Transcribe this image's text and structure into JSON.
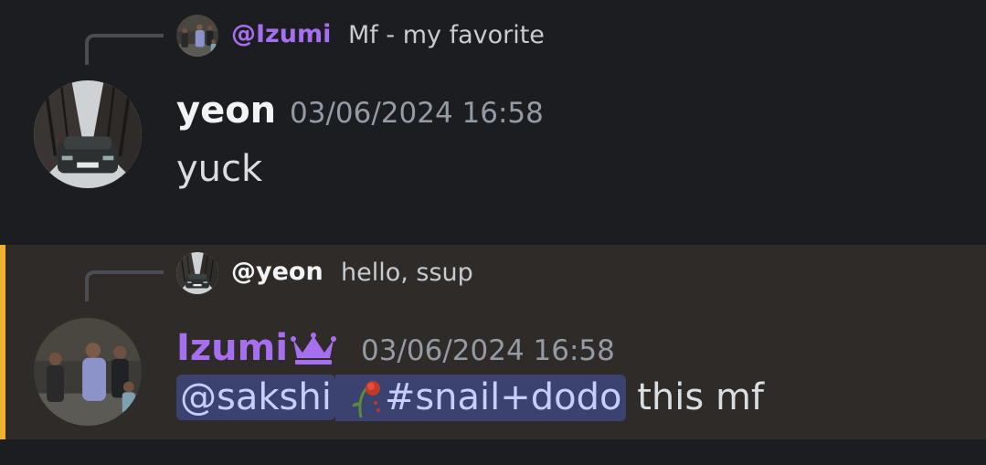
{
  "colors": {
    "background": "#1c1d21",
    "highlight_background": "#2e2b28",
    "mention_bar": "#f0b132",
    "izumi_name": "#a66ff0",
    "yeon_name": "#f2f3f5",
    "timestamp": "#949ba4",
    "mention_pill": "#3c4270"
  },
  "messages": [
    {
      "reply": {
        "avatar": "group-photo-avatar",
        "name": "@Izumi",
        "text": "Mf - my favorite"
      },
      "avatar": "car-forest-avatar",
      "username": "yeon",
      "timestamp": "03/06/2024 16:58",
      "content": "yuck"
    },
    {
      "highlighted": true,
      "reply": {
        "avatar": "car-forest-avatar",
        "name": "@yeon",
        "text": "hello, ssup"
      },
      "avatar": "group-photo-avatar",
      "username": "Izumi",
      "badge_icon": "crown-icon",
      "timestamp": "03/06/2024 16:58",
      "mention_user": "@sakshi",
      "mention_emoji": "wilted-rose-emoji",
      "mention_channel": "#snail+dodo",
      "content_suffix": "this mf"
    }
  ]
}
